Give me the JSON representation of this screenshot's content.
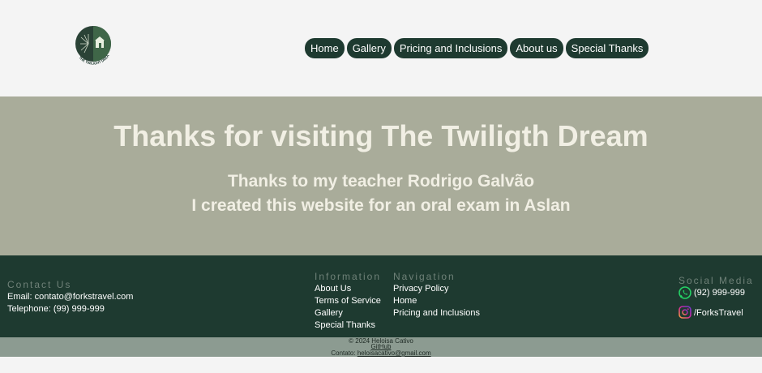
{
  "header": {
    "logo_text": "THE TWILIGHT DREAM",
    "nav": [
      "Home",
      "Gallery",
      "Pricing and Inclusions",
      "About us",
      "Special Thanks"
    ]
  },
  "hero": {
    "title": "Thanks for visiting The Twiligth Dream",
    "line1": "Thanks to my teacher Rodrigo Galvão",
    "line2": "I created this website for an oral exam in Aslan"
  },
  "footer": {
    "contact": {
      "heading": "Contact Us",
      "email": "Email: contato@forkstravel.com",
      "phone": "Telephone: (99) 999-999"
    },
    "information": {
      "heading": "Information",
      "items": [
        "About Us",
        "Terms of Service",
        "Gallery",
        "Special Thanks"
      ]
    },
    "navigation": {
      "heading": "Navigation",
      "items": [
        "Privacy Policy",
        "Home",
        "Pricing and Inclusions"
      ]
    },
    "social": {
      "heading": "Social Media",
      "whatsapp": "(92) 999-999",
      "instagram": "/ForksTravel",
      "colors": {
        "whatsapp": "#25d366",
        "instagram": "#d6249f"
      }
    }
  },
  "bottom": {
    "copyright": "© 2024 Heloisa Cativo",
    "github": "GitHub",
    "contact_prefix": "Contato: ",
    "contact_email": "heloisacativo@gmail.com"
  },
  "colors": {
    "primary": "#1e3a30",
    "hero_bg": "#a9ac9a",
    "bottom_bar": "#8c9b91"
  }
}
